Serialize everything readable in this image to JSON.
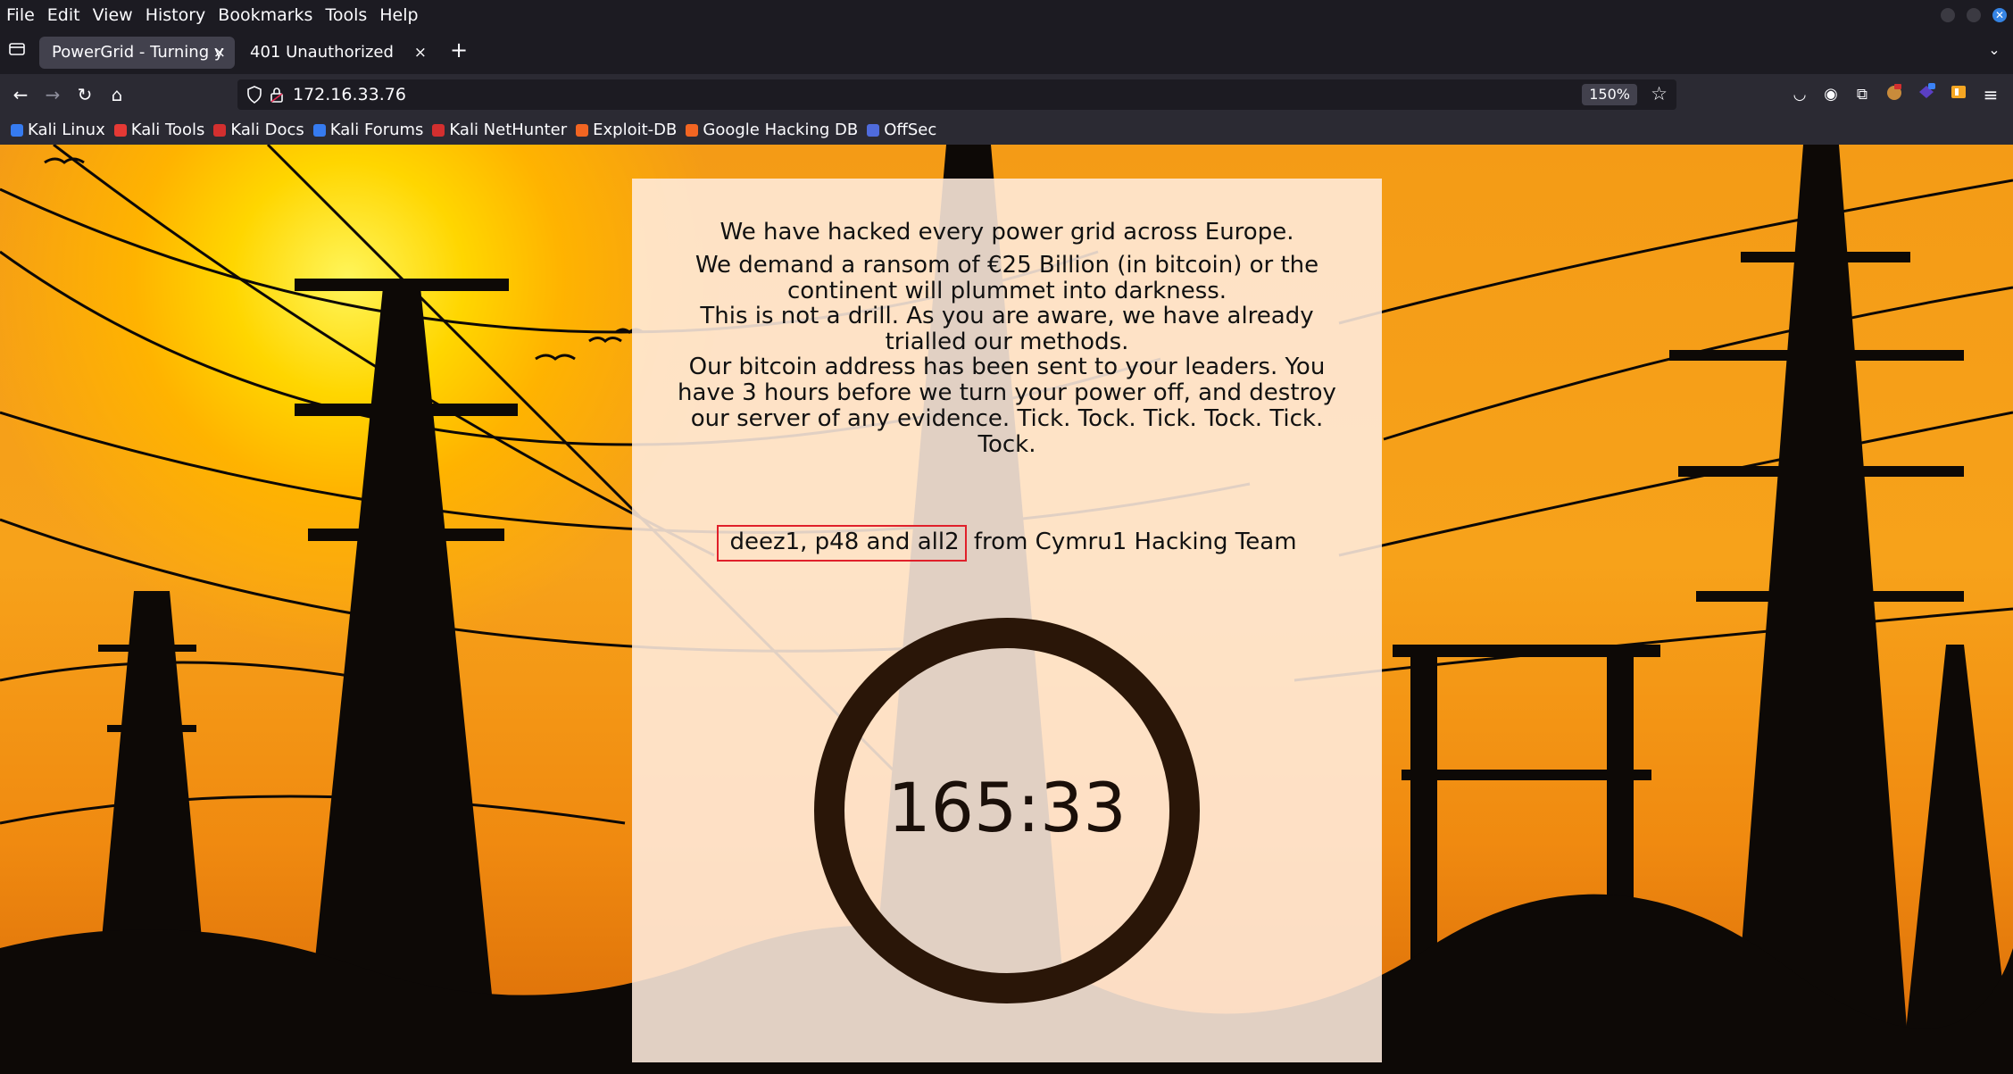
{
  "menu": [
    "File",
    "Edit",
    "View",
    "History",
    "Bookmarks",
    "Tools",
    "Help"
  ],
  "tabs": [
    {
      "title": "PowerGrid - Turning y",
      "close": "×",
      "active": true
    },
    {
      "title": "401 Unauthorized",
      "close": "×",
      "active": false
    }
  ],
  "new_tab_label": "+",
  "toolbar": {
    "url": "172.16.33.76",
    "zoom": "150%"
  },
  "bookmarks": [
    {
      "label": "Kali Linux",
      "color": "#367bf0"
    },
    {
      "label": "Kali Tools",
      "color": "#e53935"
    },
    {
      "label": "Kali Docs",
      "color": "#d32f2f"
    },
    {
      "label": "Kali Forums",
      "color": "#367bf0"
    },
    {
      "label": "Kali NetHunter",
      "color": "#d32f2f"
    },
    {
      "label": "Exploit-DB",
      "color": "#f26522"
    },
    {
      "label": "Google Hacking DB",
      "color": "#f26522"
    },
    {
      "label": "OffSec",
      "color": "#4f6bdc"
    }
  ],
  "page": {
    "para1": "We have hacked every power grid across Europe.",
    "para2": "We demand a ransom of €25 Billion (in bitcoin) or the continent will plummet into darkness.",
    "para3": "This is not a drill. As you are aware, we have already trialled our methods.",
    "para4": "Our bitcoin address has been sent to your leaders. You have 3 hours before we turn your power off, and destroy our server of any evidence. Tick. Tock. Tick. Tock. Tick. Tock.",
    "signature_names": "deez1, p48 and all2",
    "signature_rest": " from Cymru1 Hacking Team",
    "timer": "165:33"
  },
  "colors": {
    "accent_highlight": "#e0202a",
    "ring": "#2a1608",
    "sky": "#f49b16"
  }
}
